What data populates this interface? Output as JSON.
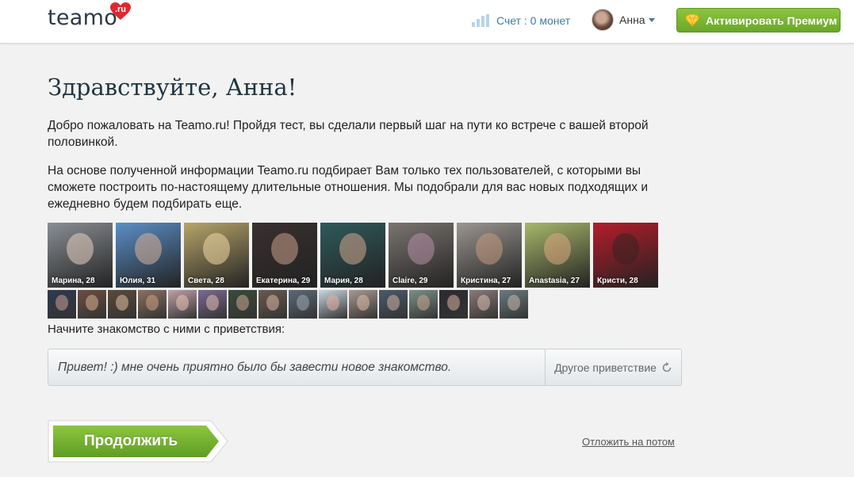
{
  "header": {
    "logo_text": "teamo",
    "logo_badge": ".ru",
    "balance_text": "Счет : 0 монет",
    "user_name": "Анна",
    "premium_button": "Активировать Премиум"
  },
  "main": {
    "title": "Здравствуйте, Анна!",
    "paragraph1": "Добро пожаловать на Teamo.ru! Пройдя тест, вы сделали первый шаг на пути ко встрече с вашей второй половинкой.",
    "paragraph2": "На основе полученной информации Teamo.ru подбирает Вам только тех пользователей, с которыми вы сможете построить по-настоящему длительные отношения. Мы подобрали для вас новых подходящих и ежедневно будем подбирать еще.",
    "featured_profiles": [
      {
        "caption": "Марина, 28",
        "bg": "#8a8f95",
        "tone": "#e8d0c0"
      },
      {
        "caption": "Юлия, 31",
        "bg": "#5b8fc7",
        "tone": "#d9b29a"
      },
      {
        "caption": "Света, 28",
        "bg": "#b8a56a",
        "tone": "#f0d9a8"
      },
      {
        "caption": "Екатерина, 29",
        "bg": "#3a3030",
        "tone": "#c9a08a"
      },
      {
        "caption": "Мария, 28",
        "bg": "#2f5a5c",
        "tone": "#d4a88c"
      },
      {
        "caption": "Claire, 29",
        "bg": "#7a7570",
        "tone": "#b48fa8"
      },
      {
        "caption": "Кристина, 27",
        "bg": "#9a9690",
        "tone": "#c49a80"
      },
      {
        "caption": "Anastasia, 27",
        "bg": "#a8b86a",
        "tone": "#e0a880"
      },
      {
        "caption": "Кристи, 28",
        "bg": "#b51d2a",
        "tone": "#3a2020"
      }
    ],
    "more_profiles": [
      {
        "bg": "#2e3a50",
        "tone": "#c8a090"
      },
      {
        "bg": "#6a5040",
        "tone": "#d8b090"
      },
      {
        "bg": "#5a4a3a",
        "tone": "#e0c0a0"
      },
      {
        "bg": "#8a7060",
        "tone": "#d0a080"
      },
      {
        "bg": "#c0a0a8",
        "tone": "#e8c8b8"
      },
      {
        "bg": "#7a6a90",
        "tone": "#e0c0b0"
      },
      {
        "bg": "#3a4a3a",
        "tone": "#c8a890"
      },
      {
        "bg": "#6a5a50",
        "tone": "#d8b8a0"
      },
      {
        "bg": "#5a6a78",
        "tone": "#a0a8b0"
      },
      {
        "bg": "#c8d8e0",
        "tone": "#e8b0a0"
      },
      {
        "bg": "#a89890",
        "tone": "#e0c0a8"
      },
      {
        "bg": "#4a5a6a",
        "tone": "#d0b0a0"
      },
      {
        "bg": "#7a9088",
        "tone": "#c8a890"
      },
      {
        "bg": "#2a2a30",
        "tone": "#d8b0a0"
      },
      {
        "bg": "#8a7a78",
        "tone": "#d8c0b0"
      },
      {
        "bg": "#6a7a80",
        "tone": "#c8b8a8"
      }
    ],
    "greeting_label": "Начните знакомство с ними с приветствия:",
    "greeting_text": "Привет! :) мне очень приятно было бы завести новое знакомство.",
    "other_greeting": "Другое приветствие",
    "continue_button": "Продолжить",
    "later_link": "Отложить на потом"
  },
  "colors": {
    "accent_green": "#7ab83a",
    "link_blue": "#3d7ca5",
    "logo_red": "#e2262e"
  }
}
